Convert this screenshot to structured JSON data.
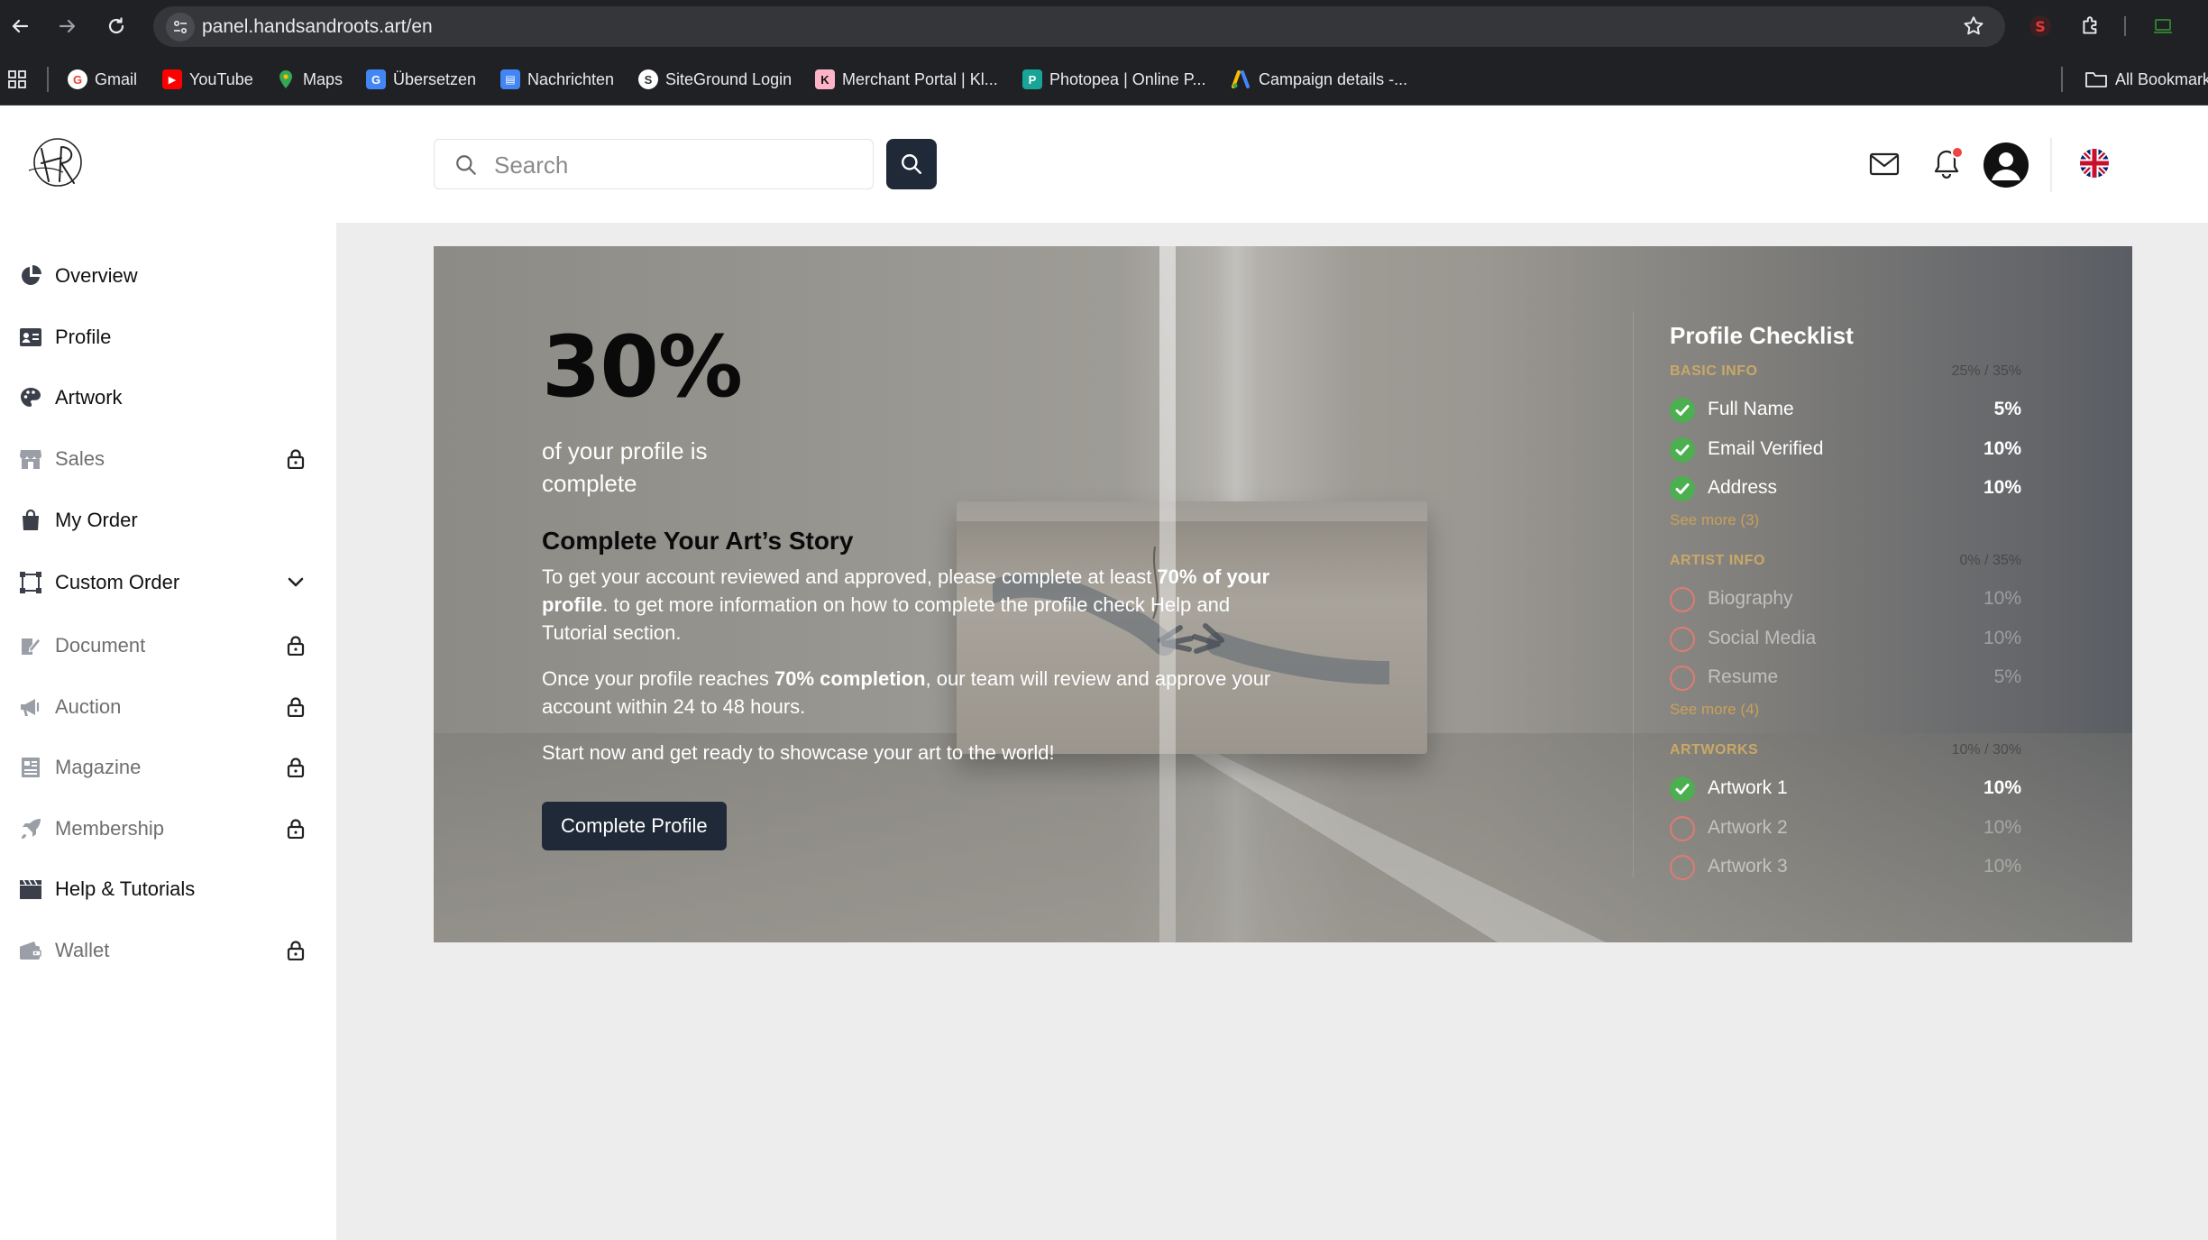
{
  "browser": {
    "url": "panel.handsandroots.art/en",
    "bookmarks": [
      {
        "label": "Gmail",
        "color": "#ea4335",
        "glyph": "G"
      },
      {
        "label": "YouTube",
        "color": "#ff0000",
        "glyph": "▶"
      },
      {
        "label": "Maps",
        "color": "#34a853",
        "glyph": "◉"
      },
      {
        "label": "Übersetzen",
        "color": "#4285f4",
        "glyph": "G"
      },
      {
        "label": "Nachrichten",
        "color": "#4285f4",
        "glyph": "▤"
      },
      {
        "label": "SiteGround Login",
        "color": "#ffffff",
        "glyph": "S"
      },
      {
        "label": "Merchant Portal | Kl...",
        "color": "#ffb3c7",
        "glyph": "K"
      },
      {
        "label": "Photopea | Online P...",
        "color": "#18a497",
        "glyph": "P"
      },
      {
        "label": "Campaign details -...",
        "color": "#fbbc04",
        "glyph": "▲"
      }
    ],
    "all_bookmarks": "All Bookmarks"
  },
  "header": {
    "search_placeholder": "Search"
  },
  "sidebar": {
    "items": [
      {
        "label": "Overview",
        "icon": "pie-chart-icon",
        "locked": false
      },
      {
        "label": "Profile",
        "icon": "id-card-icon",
        "locked": false
      },
      {
        "label": "Artwork",
        "icon": "palette-icon",
        "locked": false
      },
      {
        "label": "Sales",
        "icon": "store-icon",
        "locked": true
      },
      {
        "label": "My Order",
        "icon": "shopping-bag-icon",
        "locked": false
      },
      {
        "label": "Custom Order",
        "icon": "crop-icon",
        "locked": false,
        "expandable": true
      },
      {
        "label": "Document",
        "icon": "document-edit-icon",
        "locked": true
      },
      {
        "label": "Auction",
        "icon": "megaphone-icon",
        "locked": true
      },
      {
        "label": "Magazine",
        "icon": "magazine-icon",
        "locked": true
      },
      {
        "label": "Membership",
        "icon": "rocket-icon",
        "locked": true
      },
      {
        "label": "Help & Tutorials",
        "icon": "clapperboard-icon",
        "locked": false
      },
      {
        "label": "Wallet",
        "icon": "wallet-icon",
        "locked": true
      }
    ]
  },
  "banner": {
    "percent": "30%",
    "percent_sub": "of your profile is complete",
    "title": "Complete Your Art’s Story",
    "p1_a": "To get your account reviewed and approved, please complete at least ",
    "p1_b": "70% of your profile",
    "p1_c": ". to get more information on how to complete the profile check Help and Tutorial section.",
    "p2_a": "Once your profile reaches ",
    "p2_b": "70% completion",
    "p2_c": ", our team will review and approve your account within 24 to 48 hours.",
    "p3": "Start now and get ready to showcase your art to the world!",
    "cta": "Complete Profile"
  },
  "checklist": {
    "title": "Profile Checklist",
    "sections": [
      {
        "heading": "BASIC INFO",
        "ratio": "25% / 35%",
        "items": [
          {
            "name": "Full Name",
            "value": "5%",
            "done": true
          },
          {
            "name": "Email Verified",
            "value": "10%",
            "done": true
          },
          {
            "name": "Address",
            "value": "10%",
            "done": true
          }
        ],
        "more": "See more (3)"
      },
      {
        "heading": "ARTIST INFO",
        "ratio": "0% / 35%",
        "items": [
          {
            "name": "Biography",
            "value": "10%",
            "done": false
          },
          {
            "name": "Social Media",
            "value": "10%",
            "done": false
          },
          {
            "name": "Resume",
            "value": "5%",
            "done": false
          }
        ],
        "more": "See more (4)"
      },
      {
        "heading": "ARTWORKS",
        "ratio": "10% / 30%",
        "items": [
          {
            "name": "Artwork 1",
            "value": "10%",
            "done": true
          },
          {
            "name": "Artwork 2",
            "value": "10%",
            "done": false
          },
          {
            "name": "Artwork 3",
            "value": "10%",
            "done": false
          }
        ]
      }
    ]
  }
}
